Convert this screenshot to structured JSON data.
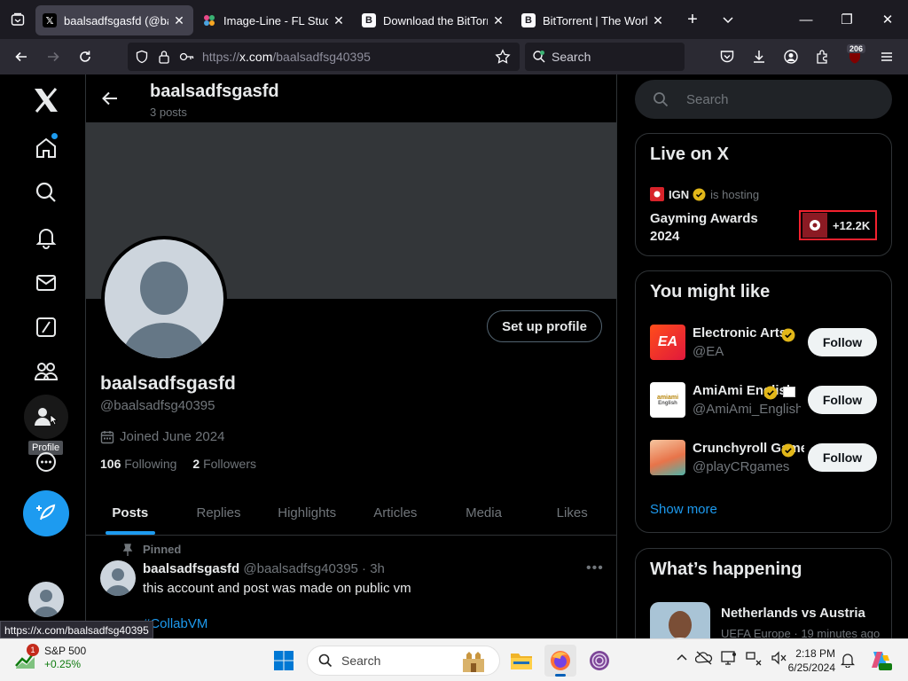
{
  "browser": {
    "tabs": [
      {
        "title": "baalsadfsgasfd (@baalsa",
        "favicon": "x-logo",
        "active": true
      },
      {
        "title": "Image-Line - FL Studio",
        "favicon": "fl-logo",
        "active": false
      },
      {
        "title": "Download the BitTorrent",
        "favicon": "bittorrent-b",
        "active": false
      },
      {
        "title": "BitTorrent | The World's",
        "favicon": "bittorrent-b",
        "active": false
      }
    ],
    "url_prefix": "https://",
    "url_host": "x.com",
    "url_path": "/baalsadfsg40395",
    "search_placeholder": "Search",
    "extension_badge": "206",
    "status_url": "https://x.com/baalsadfsg40395"
  },
  "leftnav": {
    "tooltip": "Profile"
  },
  "profile": {
    "header_name": "baalsadfsgasfd",
    "post_count": "3 posts",
    "setup_button": "Set up profile",
    "display_name": "baalsadfsgasfd",
    "handle": "@baalsadfsg40395",
    "joined": "Joined June 2024",
    "following_count": "106",
    "following_label": "Following",
    "followers_count": "2",
    "followers_label": "Followers",
    "tabs": [
      "Posts",
      "Replies",
      "Highlights",
      "Articles",
      "Media",
      "Likes"
    ],
    "active_tab": "Posts"
  },
  "post": {
    "pinned_label": "Pinned",
    "author": "baalsadfsgasfd",
    "handle_time": "@baalsadfsg40395 · 3h",
    "text": "this account and post was made on public vm",
    "tag": "#CollabVM"
  },
  "sidebar": {
    "search_placeholder": "Search",
    "live": {
      "title": "Live on X",
      "host": "IGN",
      "hosting_label": "is hosting",
      "event_title": "Gayming Awards 2024",
      "listeners": "+12.2K"
    },
    "might_like": {
      "title": "You might like",
      "accounts": [
        {
          "name": "Electronic Arts",
          "handle": "@EA",
          "button": "Follow"
        },
        {
          "name": "AmiAmi English",
          "handle": "@AmiAmi_English",
          "button": "Follow"
        },
        {
          "name": "Crunchyroll Games",
          "handle": "@playCRgames",
          "button": "Follow"
        }
      ],
      "show_more": "Show more"
    },
    "happening": {
      "title": "What’s happening",
      "trend_title": "Netherlands vs Austria",
      "trend_meta": "UEFA Europe · 19 minutes ago"
    }
  },
  "taskbar": {
    "ticker_name": "S&P 500",
    "ticker_change": "+0.25%",
    "ticker_badge": "1",
    "search_placeholder": "Search",
    "time": "2:18 PM",
    "date": "6/25/2024"
  },
  "colors": {
    "accent": "#1d9bf0",
    "background": "#000000",
    "border": "#2f3336",
    "muted_text": "#71767b",
    "live_red": "#f4212e"
  }
}
